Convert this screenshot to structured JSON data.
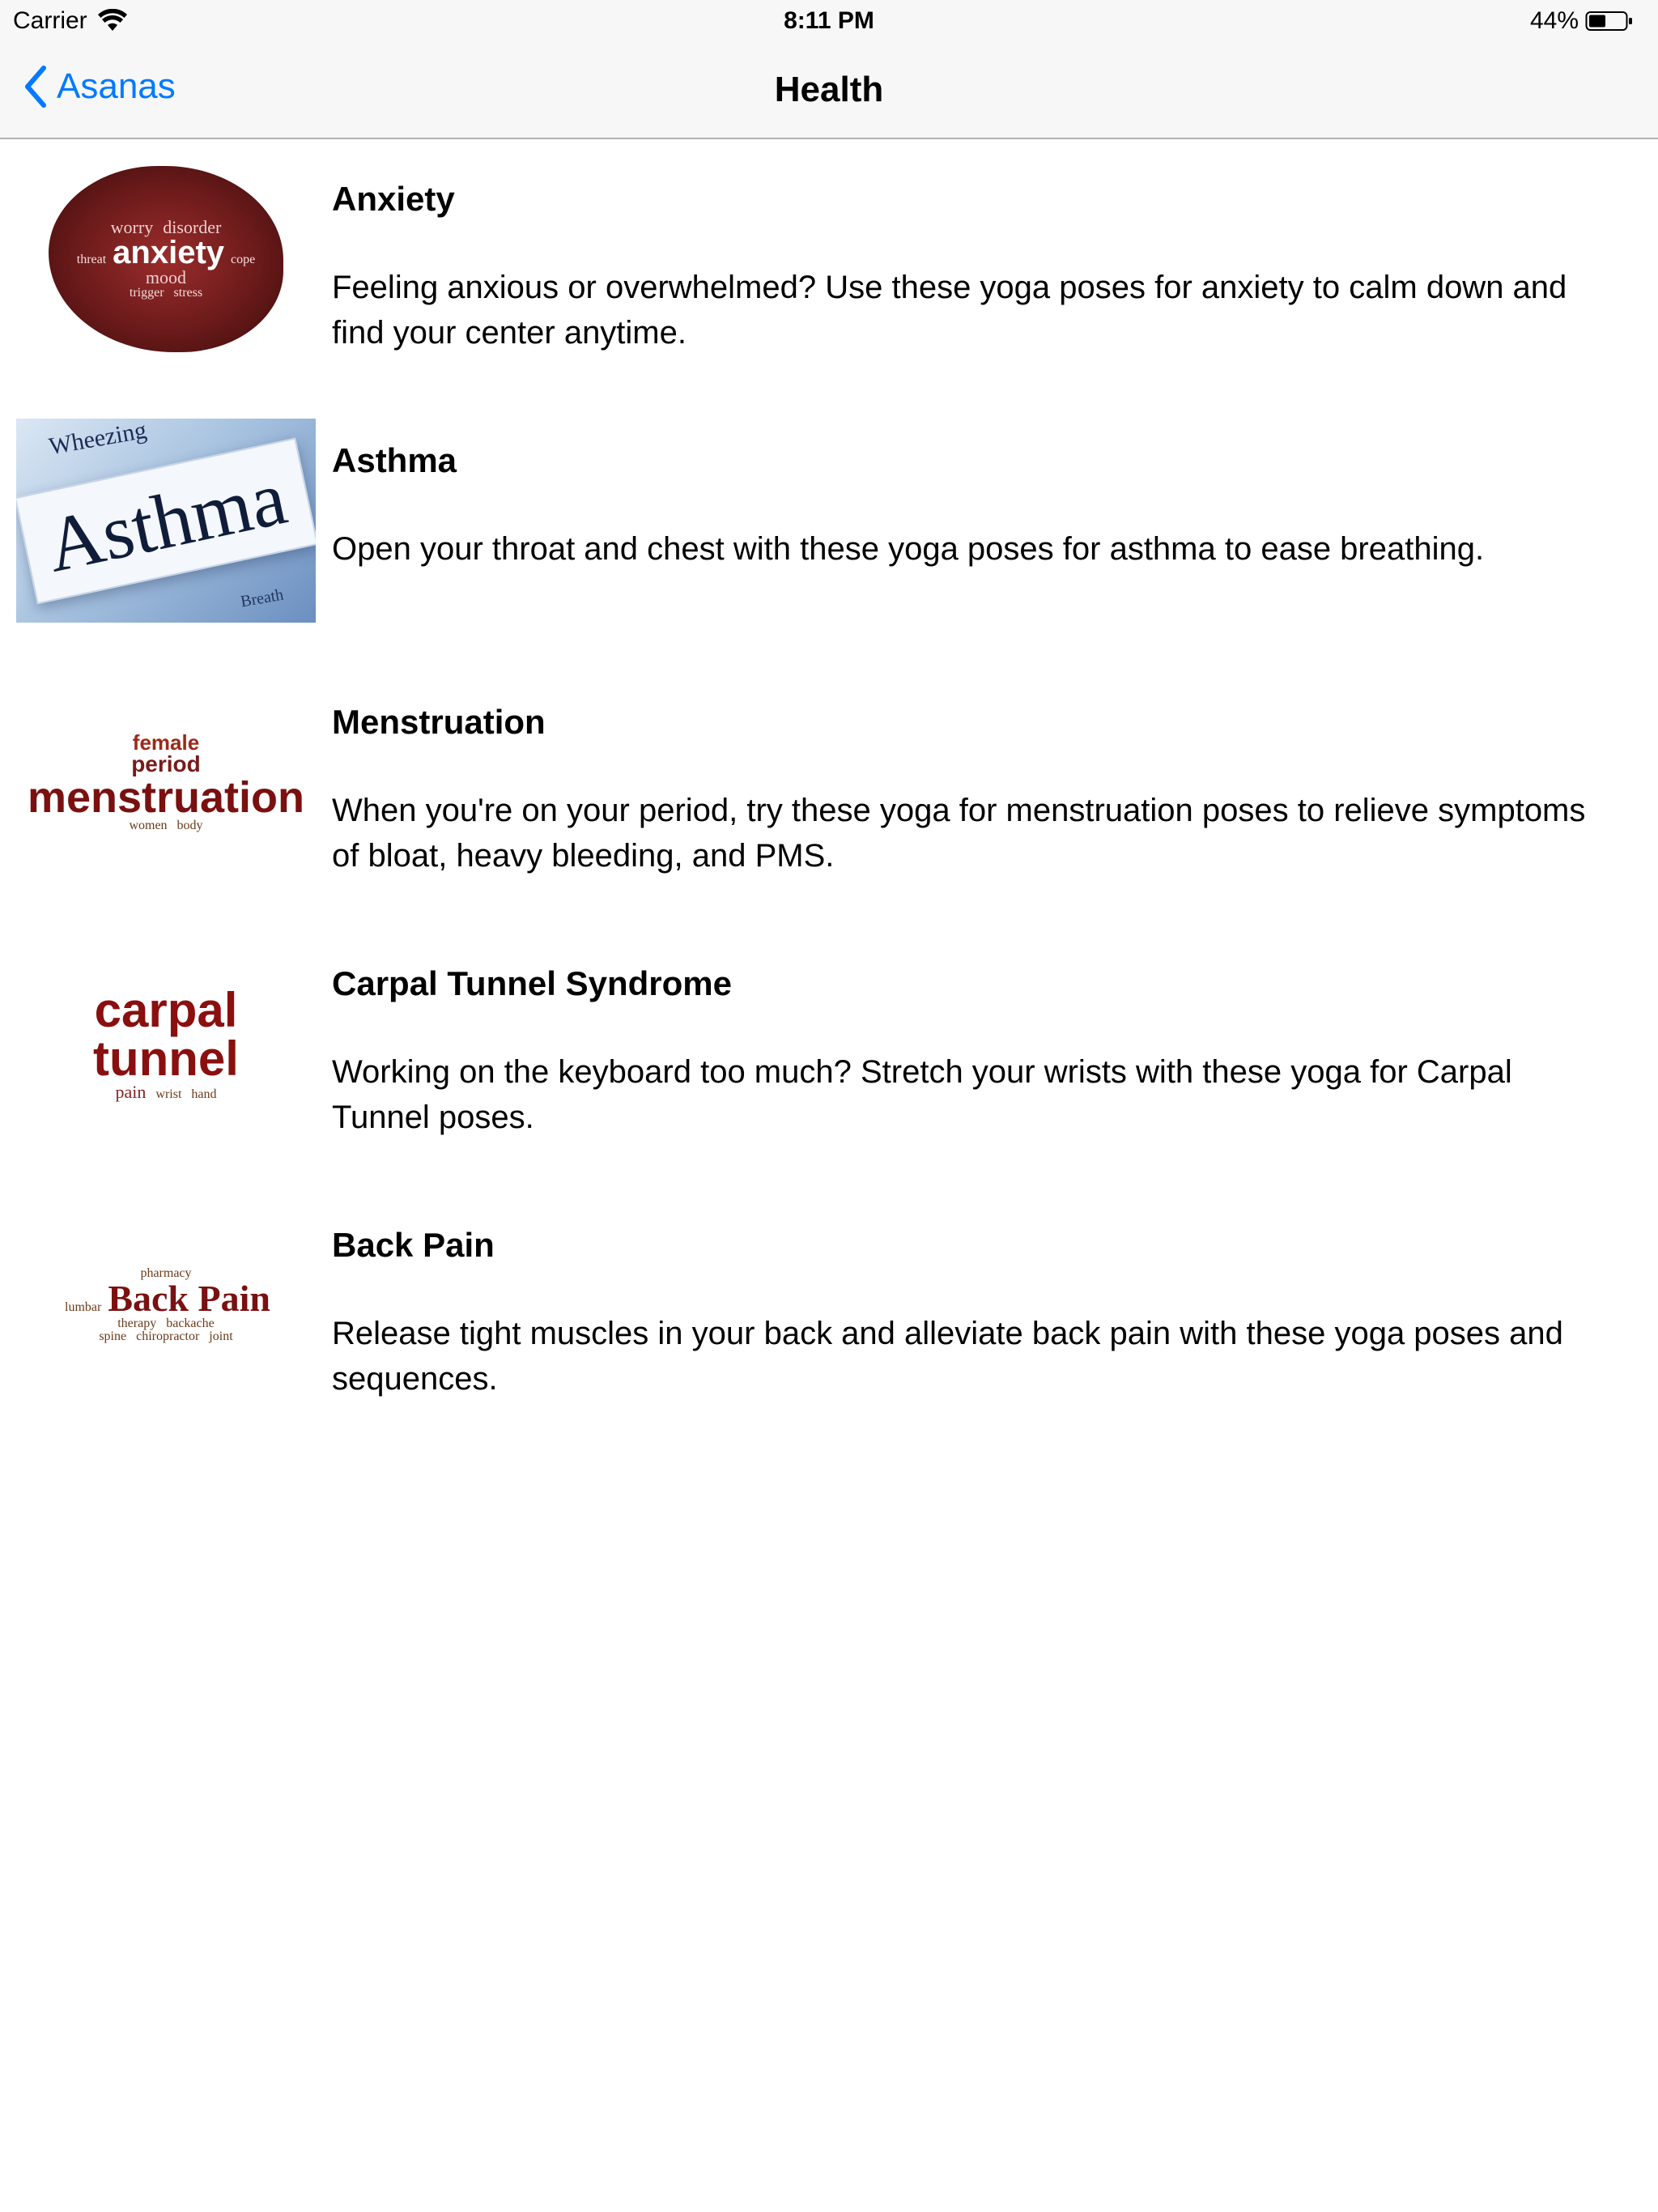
{
  "status_bar": {
    "carrier": "Carrier",
    "time": "8:11 PM",
    "battery_percent": "44%",
    "icons": [
      "wifi-icon",
      "battery-icon"
    ]
  },
  "nav": {
    "back_label": "Asanas",
    "title": "Health",
    "accent_color": "#007aff"
  },
  "items": [
    {
      "title": "Anxiety",
      "description": "Feeling anxious or overwhelmed? Use these yoga poses for anxiety to calm down and find your center anytime.",
      "thumb_text": "anxiety",
      "thumb_words": [
        "worry",
        "disorder",
        "threat",
        "cope",
        "mood",
        "trigger",
        "stress"
      ]
    },
    {
      "title": "Asthma",
      "description": "Open your throat and chest with these yoga poses for asthma to ease breathing.",
      "thumb_text": "Asthma",
      "thumb_words": [
        "Wheezing",
        "Breath"
      ]
    },
    {
      "title": "Menstruation",
      "description": "When you're on your period, try these yoga for menstruation poses to relieve symptoms of bloat, heavy bleeding, and PMS.",
      "thumb_text": "menstruation",
      "thumb_words": [
        "female",
        "period",
        "women",
        "body"
      ]
    },
    {
      "title": "Carpal Tunnel Syndrome",
      "description": "Working on the keyboard too much? Stretch your wrists with these yoga for Carpal Tunnel poses.",
      "thumb_text": "carpal tunnel",
      "thumb_words": [
        "pain",
        "wrist",
        "hand"
      ]
    },
    {
      "title": "Back Pain",
      "description": "Release tight muscles in your back and alleviate back pain with these yoga poses and sequences.",
      "thumb_text": "Back Pain",
      "thumb_words": [
        "pharmacy",
        "lumbar",
        "therapy",
        "backache",
        "spine",
        "chiropractor",
        "joint"
      ]
    }
  ]
}
